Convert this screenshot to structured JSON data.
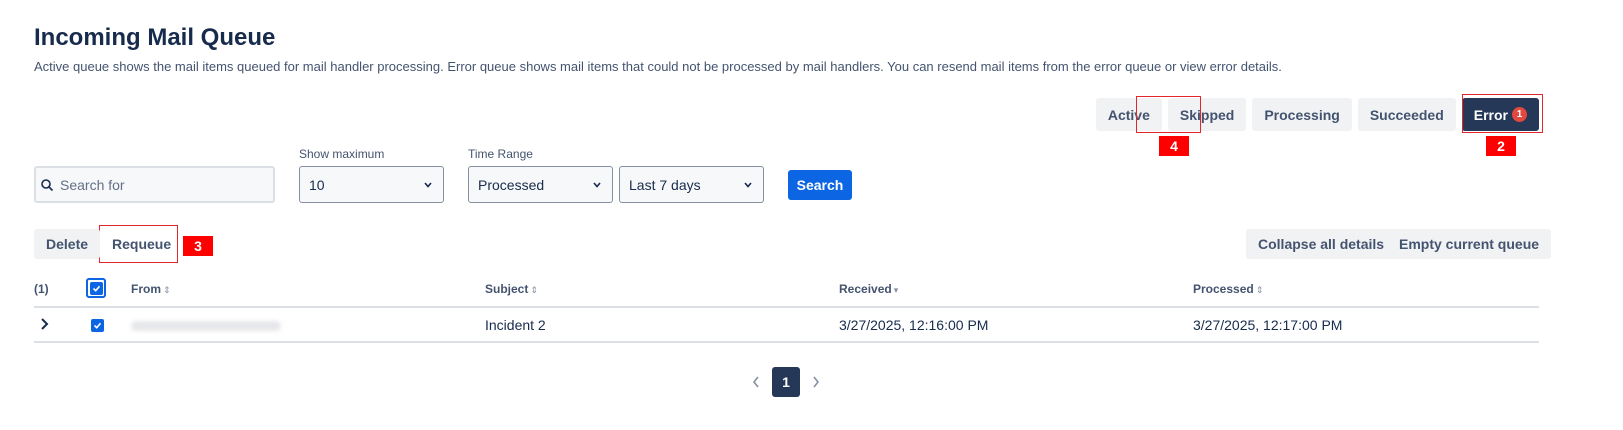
{
  "page": {
    "title": "Incoming Mail Queue",
    "description": "Active queue shows the mail items queued for mail handler processing. Error queue shows mail items that could not be processed by mail handlers. You can resend mail items from the error queue or view error details."
  },
  "tabs": [
    {
      "label": "Active",
      "selected": false
    },
    {
      "label": "Skipped",
      "selected": false
    },
    {
      "label": "Processing",
      "selected": false
    },
    {
      "label": "Succeeded",
      "selected": false
    },
    {
      "label": "Error",
      "selected": true,
      "badge": "1"
    }
  ],
  "annotations": {
    "active": "4",
    "error": "2",
    "requeue": "3"
  },
  "search": {
    "placeholder": "Search for",
    "value": ""
  },
  "filters": {
    "show_maximum_label": "Show maximum",
    "show_maximum_value": "10",
    "time_range_label": "Time Range",
    "time_range_type": "Processed",
    "time_range_period": "Last 7 days",
    "search_button": "Search"
  },
  "actions": {
    "delete": "Delete",
    "requeue": "Requeue",
    "collapse_all": "Collapse all details",
    "empty_queue": "Empty current queue"
  },
  "table": {
    "count": "(1)",
    "columns": {
      "from": "From",
      "subject": "Subject",
      "received": "Received",
      "processed": "Processed"
    },
    "rows": [
      {
        "from": "",
        "subject": "Incident 2",
        "received": "3/27/2025, 12:16:00 PM",
        "processed": "3/27/2025, 12:17:00 PM",
        "selected": true
      }
    ]
  },
  "pagination": {
    "current_page": "1"
  },
  "colors": {
    "primary": "#0c66e4",
    "selected_tab": "#253858",
    "badge": "#e2483d",
    "annotation": "#ff0000"
  }
}
